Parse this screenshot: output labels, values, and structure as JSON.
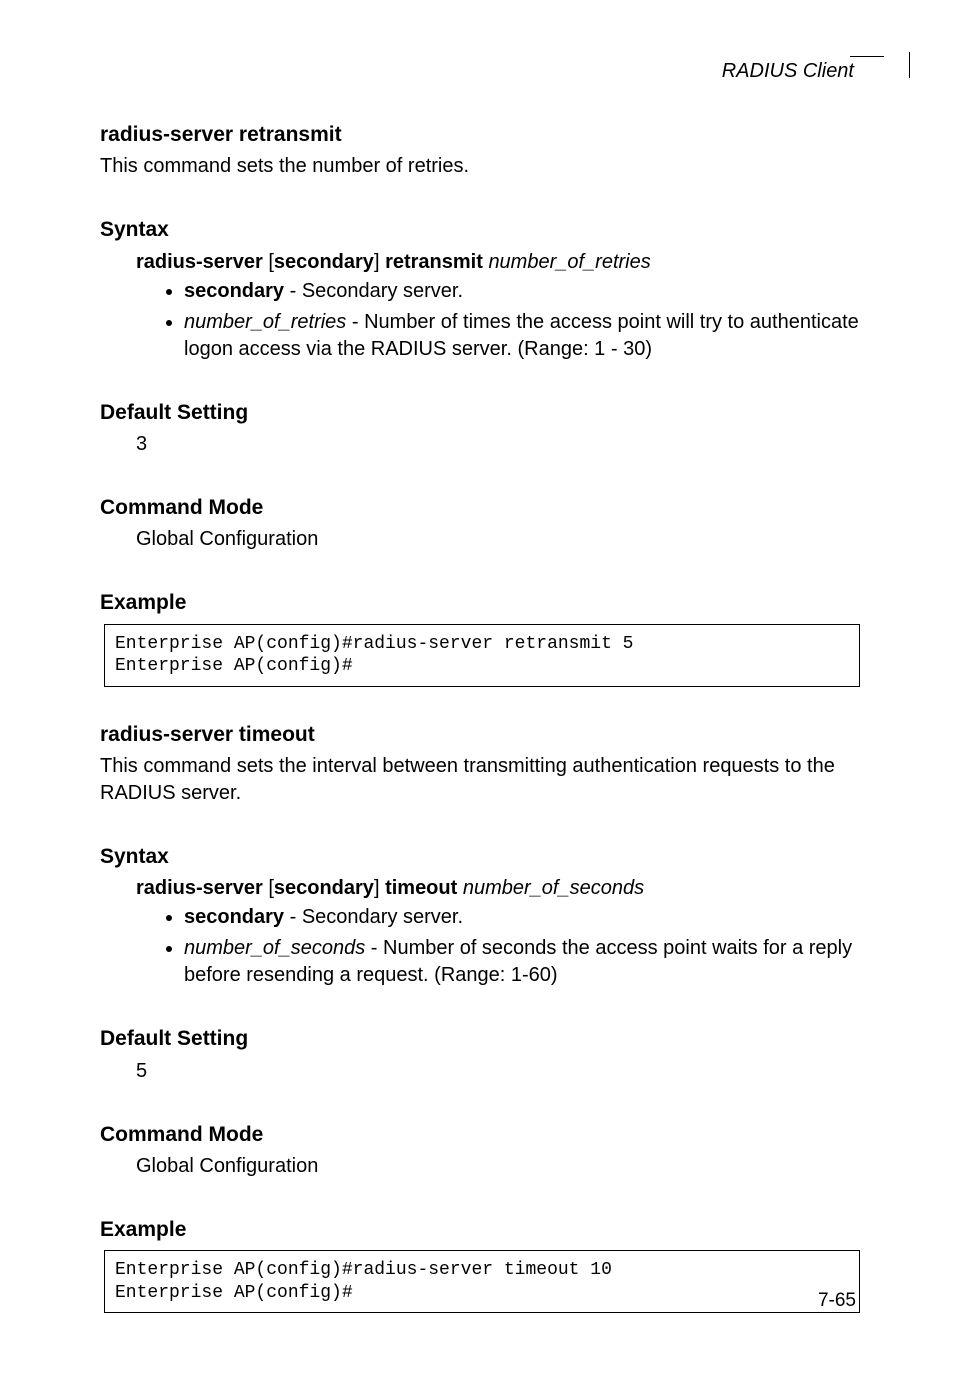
{
  "header_right": "RADIUS Client",
  "sec1": {
    "title": "radius-server retransmit",
    "intro": "This command sets the number of retries.",
    "syntax_label": "Syntax",
    "syntax_bold1": "radius-server",
    "syntax_opt": "secondary",
    "syntax_bold2": "retransmit",
    "syntax_italic": "number_of_retries",
    "bullet1_term": "secondary",
    "bullet1_desc": " - Secondary server.",
    "bullet2_term": "number_of_retries",
    "bullet2_desc": " - Number of times the access point will try to authenticate logon access via the RADIUS server. (Range: 1 - 30)",
    "default_label": "Default Setting",
    "default_value": "3",
    "mode_label": "Command Mode",
    "mode_value": "Global Configuration",
    "example_label": "Example",
    "code": "Enterprise AP(config)#radius-server retransmit 5\nEnterprise AP(config)#"
  },
  "sec2": {
    "title": "radius-server timeout",
    "intro": "This command sets the interval between transmitting authentication requests to the RADIUS server.",
    "syntax_label": "Syntax",
    "syntax_bold1": "radius-server",
    "syntax_opt": "secondary",
    "syntax_bold2": "timeout",
    "syntax_italic": "number_of_seconds",
    "bullet1_term": "secondary",
    "bullet1_desc": " - Secondary server.",
    "bullet2_term": "number_of_seconds",
    "bullet2_desc": " - Number of seconds the access point waits for a reply before resending a request. (Range: 1-60)",
    "default_label": "Default Setting",
    "default_value": "5",
    "mode_label": "Command Mode",
    "mode_value": "Global Configuration",
    "example_label": "Example",
    "code": "Enterprise AP(config)#radius-server timeout 10\nEnterprise AP(config)#"
  },
  "page_number": "7-65"
}
